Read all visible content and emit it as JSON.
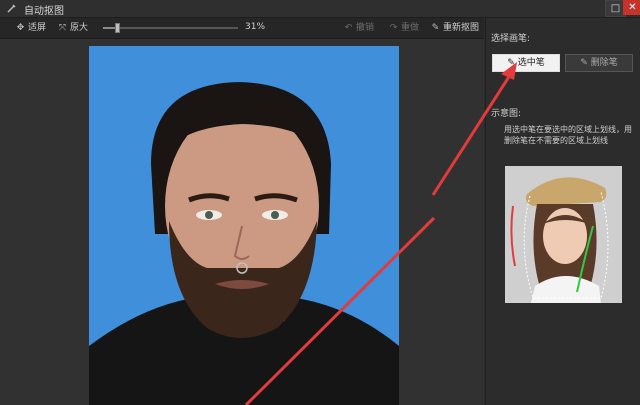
{
  "window": {
    "title": "自动抠图",
    "maximize_glyph": "□",
    "close_glyph": "✕"
  },
  "toolbar": {
    "fit_label": "适屏",
    "zoom_label": "原大",
    "zoom_value": "31%",
    "zoom_fraction": 0.09,
    "undo_label": "撤销",
    "redo_label": "重做",
    "redraw_label": "重新抠图"
  },
  "panel": {
    "select_pen_heading": "选择画笔:",
    "select_pen_label": "选中笔",
    "delete_pen_label": "删除笔",
    "example_heading": "示意图:",
    "description": "用选中笔在要选中的区域上划线，用删除笔在不需要的区域上划线"
  },
  "icons": [
    "tool-icon",
    "fit-screen-icon",
    "actual-size-icon",
    "undo-icon",
    "redo-icon",
    "redraw-icon",
    "select-pen-icon",
    "delete-pen-icon"
  ],
  "colors": {
    "photo_background": "#3f8fdb",
    "annotation_arrow": "#e23b3b",
    "active_button": "#f2f2f2",
    "close_button": "#c7332b"
  }
}
